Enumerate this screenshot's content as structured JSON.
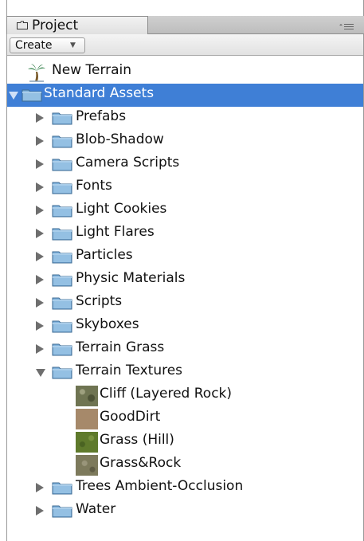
{
  "window": {
    "tab_title": "Project"
  },
  "toolbar": {
    "create_label": "Create"
  },
  "tree": [
    {
      "label": "New Terrain",
      "kind": "terrain",
      "depth": 0
    },
    {
      "label": "Standard Assets",
      "kind": "folder",
      "depth": 0,
      "expanded": true,
      "selected": true
    },
    {
      "label": " Prefabs",
      "kind": "folder",
      "depth": 1,
      "expanded": false
    },
    {
      "label": "Blob-Shadow",
      "kind": "folder",
      "depth": 1,
      "expanded": false
    },
    {
      "label": "Camera Scripts",
      "kind": "folder",
      "depth": 1,
      "expanded": false
    },
    {
      "label": "Fonts",
      "kind": "folder",
      "depth": 1,
      "expanded": false
    },
    {
      "label": "Light Cookies",
      "kind": "folder",
      "depth": 1,
      "expanded": false
    },
    {
      "label": "Light Flares",
      "kind": "folder",
      "depth": 1,
      "expanded": false
    },
    {
      "label": "Particles",
      "kind": "folder",
      "depth": 1,
      "expanded": false
    },
    {
      "label": "Physic Materials",
      "kind": "folder",
      "depth": 1,
      "expanded": false
    },
    {
      "label": "Scripts",
      "kind": "folder",
      "depth": 1,
      "expanded": false
    },
    {
      "label": "Skyboxes",
      "kind": "folder",
      "depth": 1,
      "expanded": false
    },
    {
      "label": "Terrain Grass",
      "kind": "folder",
      "depth": 1,
      "expanded": false
    },
    {
      "label": "Terrain Textures",
      "kind": "folder",
      "depth": 1,
      "expanded": true
    },
    {
      "label": "Cliff (Layered Rock)",
      "kind": "texture",
      "depth": 2,
      "texture": "rock"
    },
    {
      "label": "GoodDirt",
      "kind": "texture",
      "depth": 2,
      "texture": "dirt"
    },
    {
      "label": "Grass (Hill)",
      "kind": "texture",
      "depth": 2,
      "texture": "grass"
    },
    {
      "label": "Grass&Rock",
      "kind": "texture",
      "depth": 2,
      "texture": "grassrock"
    },
    {
      "label": "Trees Ambient-Occlusion",
      "kind": "folder",
      "depth": 1,
      "expanded": false
    },
    {
      "label": "Water",
      "kind": "folder",
      "depth": 1,
      "expanded": false
    }
  ],
  "colors": {
    "selection": "#3f7fd6",
    "folder_body": "#7fb2dc",
    "folder_tab": "#a9cdea",
    "texture_rock": "#6f7452",
    "texture_dirt": "#a6896a",
    "texture_grass": "#5f7a2c",
    "texture_grassrock": "#7d7a5c"
  },
  "icons": {
    "tab": "folder-icon",
    "menu": "panel-menu-icon",
    "terrain": "palm-tree-icon",
    "folder": "folder-icon",
    "texture": "texture-thumbnail-icon"
  }
}
